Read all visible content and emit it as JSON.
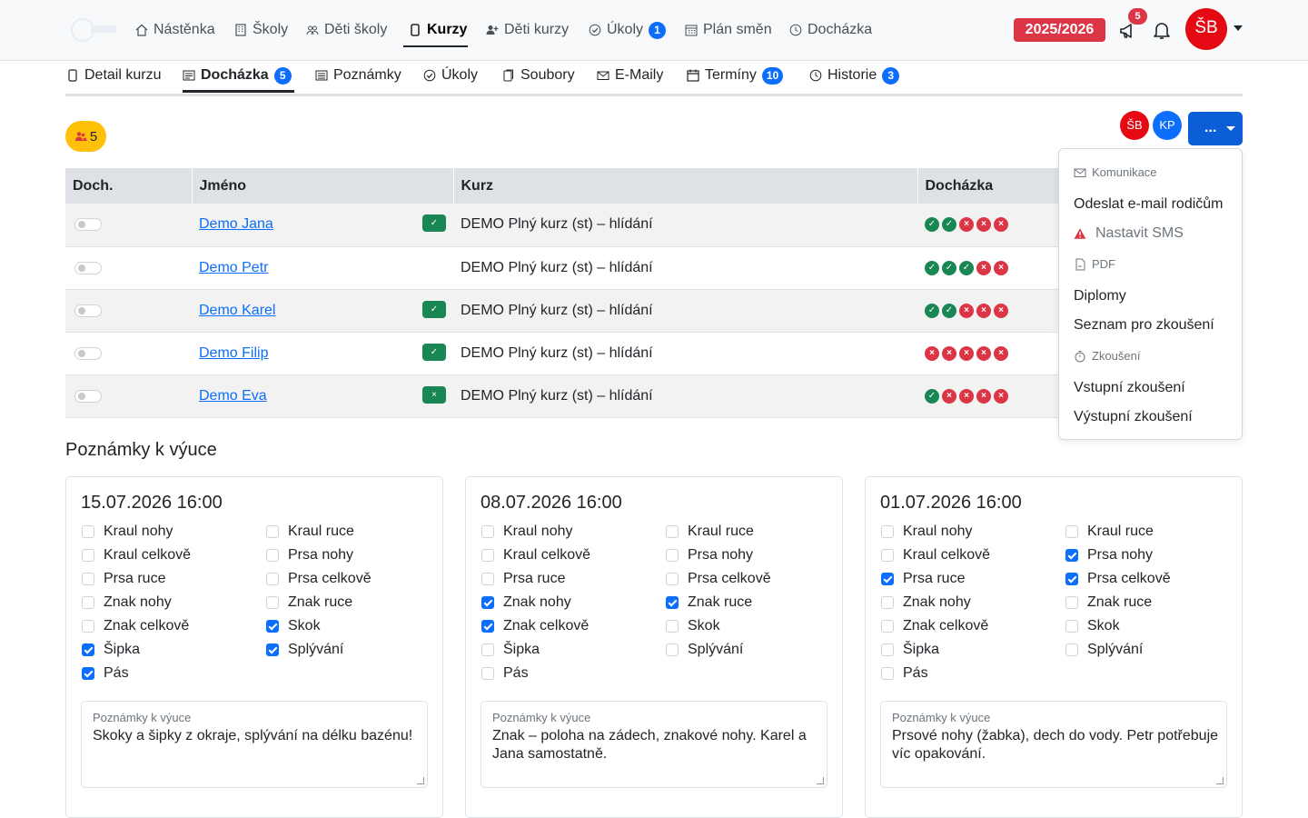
{
  "nav": {
    "items": [
      {
        "label": "Nástěnka",
        "icon": "home-icon"
      },
      {
        "label": "Školy",
        "icon": "building-icon"
      },
      {
        "label": "Děti školy",
        "icon": "people-icon"
      },
      {
        "label": "Kurzy",
        "icon": "tablet-icon"
      },
      {
        "label": "Děti kurzy",
        "icon": "person-add-icon"
      },
      {
        "label": "Úkoly",
        "icon": "check-circle-icon",
        "badge": "1"
      },
      {
        "label": "Plán směn",
        "icon": "calendar-grid-icon"
      },
      {
        "label": "Docházka",
        "icon": "clock-icon"
      }
    ],
    "year": "2025/2026",
    "notif_count": "5",
    "avatar": "ŠB"
  },
  "subtabs": [
    {
      "label": "Detail kurzu",
      "icon": "tablet-icon"
    },
    {
      "label": "Docházka",
      "icon": "list-icon",
      "badge": "5"
    },
    {
      "label": "Poznámky",
      "icon": "note-icon"
    },
    {
      "label": "Úkoly",
      "icon": "check-circle-icon"
    },
    {
      "label": "Soubory",
      "icon": "files-icon"
    },
    {
      "label": "E-Maily",
      "icon": "envelope-icon"
    },
    {
      "label": "Termíny",
      "icon": "calendar-icon",
      "badge": "10"
    },
    {
      "label": "Historie",
      "icon": "clock-icon",
      "badge": "3"
    }
  ],
  "toolbar": {
    "people_count": "5",
    "avatars": [
      "ŠB",
      "KP"
    ],
    "more_label": "..."
  },
  "table": {
    "headers": [
      "Doch.",
      "Jméno",
      "Kurz",
      "Docházka"
    ],
    "rows": [
      {
        "name": "Demo Jana",
        "status": "✓",
        "course": "DEMO Plný kurz (st) – hlídání",
        "attendance": [
          1,
          1,
          0,
          0,
          0
        ]
      },
      {
        "name": "Demo Petr",
        "status": "",
        "course": "DEMO Plný kurz (st) – hlídání",
        "attendance": [
          1,
          1,
          1,
          0,
          0
        ]
      },
      {
        "name": "Demo Karel",
        "status": "✓",
        "course": "DEMO Plný kurz (st) – hlídání",
        "attendance": [
          1,
          1,
          0,
          0,
          0
        ]
      },
      {
        "name": "Demo Filip",
        "status": "✓",
        "course": "DEMO Plný kurz (st) – hlídání",
        "attendance": [
          0,
          0,
          0,
          0,
          0
        ]
      },
      {
        "name": "Demo Eva",
        "status": "×",
        "course": "DEMO Plný kurz (st) – hlídání",
        "attendance": [
          1,
          0,
          0,
          0,
          0
        ]
      }
    ]
  },
  "dropdown": {
    "sections": [
      {
        "header": "Komunikace",
        "icon": "envelope-icon",
        "items": [
          {
            "label": "Odeslat e-mail rodičům"
          },
          {
            "label": "Nastavit SMS",
            "icon": "warning-icon"
          }
        ]
      },
      {
        "header": "PDF",
        "icon": "pdf-icon",
        "items": [
          {
            "label": "Diplomy"
          },
          {
            "label": "Seznam pro zkoušení"
          }
        ]
      },
      {
        "header": "Zkoušení",
        "icon": "stopwatch-icon",
        "items": [
          {
            "label": "Vstupní zkoušení"
          },
          {
            "label": "Výstupní zkoušení"
          }
        ]
      }
    ]
  },
  "notes": {
    "title": "Poznámky k výuce",
    "skills": [
      "Kraul nohy",
      "Kraul ruce",
      "Kraul celkově",
      "Prsa nohy",
      "Prsa ruce",
      "Prsa celkově",
      "Znak nohy",
      "Znak ruce",
      "Znak celkově",
      "Skok",
      "Šipka",
      "Splývání",
      "Pás"
    ],
    "cards": [
      {
        "date": "15.07.2026 16:00",
        "checked": [
          0,
          0,
          0,
          0,
          0,
          0,
          0,
          0,
          0,
          1,
          1,
          1,
          1
        ],
        "label": "Poznámky k výuce",
        "text": "Skoky a šipky z okraje, splývání na délku bazénu!"
      },
      {
        "date": "08.07.2026 16:00",
        "checked": [
          0,
          0,
          0,
          0,
          0,
          0,
          1,
          1,
          1,
          0,
          0,
          0,
          0
        ],
        "label": "Poznámky k výuce",
        "text": "Znak – poloha na zádech, znakové nohy. Karel a Jana samostatně."
      },
      {
        "date": "01.07.2026 16:00",
        "checked": [
          0,
          0,
          0,
          1,
          1,
          1,
          0,
          0,
          0,
          0,
          0,
          0,
          0
        ],
        "label": "Poznámky k výuce",
        "text": "Prsové nohy (žabka), dech do vody. Petr potřebuje víc opakování."
      }
    ]
  },
  "colors": {
    "primary": "#0d6efd",
    "danger": "#dc3545",
    "success": "#198754",
    "warning": "#ffc107",
    "avatar": "#e50914"
  }
}
